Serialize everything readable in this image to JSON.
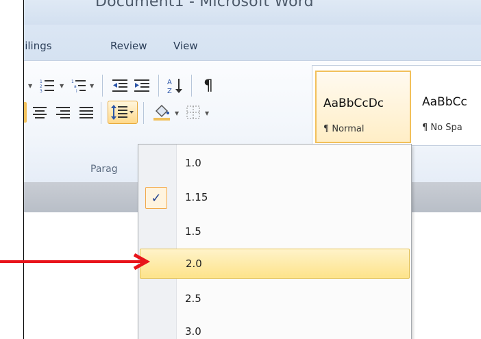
{
  "window": {
    "title": "Document1 - Microsoft Word"
  },
  "tabs": [
    {
      "label": "ailings"
    },
    {
      "label": "Review"
    },
    {
      "label": "View"
    }
  ],
  "ribbon": {
    "group_label": "Parag",
    "icons": [
      "bullets-icon",
      "numbering-icon",
      "multilevel-list-icon",
      "decrease-indent-icon",
      "increase-indent-icon",
      "sort-icon",
      "show-formatting-icon",
      "align-left-icon",
      "align-center-icon",
      "align-right-icon",
      "justify-icon",
      "line-spacing-icon",
      "shading-icon",
      "borders-icon"
    ],
    "sort_glyph": "A↓Z",
    "pilcrow": "¶"
  },
  "styles": [
    {
      "sample": "AaBbCcDc",
      "name": "¶ Normal"
    },
    {
      "sample": "AaBbCc",
      "name": "¶ No Spa"
    }
  ],
  "line_spacing_menu": {
    "items": [
      {
        "label": "1.0"
      },
      {
        "label": "1.15",
        "checked": true
      },
      {
        "label": "1.5"
      },
      {
        "label": "2.0",
        "highlighted": true
      },
      {
        "label": "2.5"
      },
      {
        "label": "3.0"
      }
    ],
    "check_glyph": "✓"
  },
  "colors": {
    "accent_orange": "#f2a94a",
    "highlight": "#fde38a",
    "annotation_red": "#e8141b"
  }
}
